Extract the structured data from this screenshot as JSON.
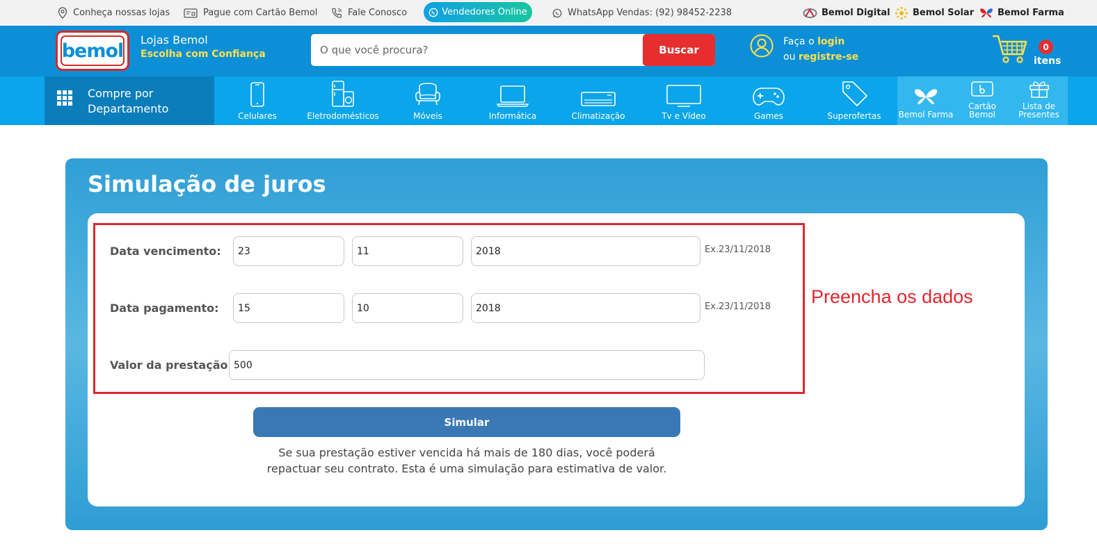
{
  "topbar": {
    "stores": "Conheça nossas lojas",
    "pay_card": "Pague com Cartão Bemol",
    "contact": "Fale Conosco",
    "sellers_online": "Vendedores Online",
    "whatsapp": "WhatsApp Vendas: (92) 98452-2238",
    "brand_digital": "Bemol Digital",
    "brand_solar": "Bemol Solar",
    "brand_farma": "Bemol Farma"
  },
  "header": {
    "logo_text": "bemol",
    "tagline_top": "Lojas Bemol",
    "tagline_bottom": "Escolha com Confiança",
    "search_placeholder": "O que você procura?",
    "search_button": "Buscar",
    "login_prefix": "Faça o",
    "login_link": "login",
    "register_prefix": "ou",
    "register_link": "registre-se",
    "cart_count": "0",
    "cart_label": "itens"
  },
  "nav": {
    "department_line1": "Compre por",
    "department_line2": "Departamento",
    "categories": [
      {
        "label": "Celulares",
        "icon": "smartphone-icon"
      },
      {
        "label": "Eletrodomésticos",
        "icon": "appliances-icon"
      },
      {
        "label": "Móveis",
        "icon": "armchair-icon"
      },
      {
        "label": "Informática",
        "icon": "laptop-icon"
      },
      {
        "label": "Climatização",
        "icon": "air-conditioner-icon"
      },
      {
        "label": "Tv e Vídeo",
        "icon": "tv-icon"
      },
      {
        "label": "Games",
        "icon": "gamepad-icon"
      },
      {
        "label": "Superofertas",
        "icon": "tag-icon"
      }
    ],
    "right_items": [
      {
        "label": "Bemol Farma",
        "icon": "butterfly-icon"
      },
      {
        "label": "Cartão Bemol",
        "icon": "card-icon"
      },
      {
        "label_line1": "Lista de",
        "label_line2": "Presentes",
        "icon": "gift-icon"
      }
    ]
  },
  "simulation": {
    "title": "Simulação de juros",
    "due_label": "Data vencimento:",
    "due_day": "23",
    "due_month": "11",
    "due_year": "2018",
    "due_hint": "Ex.23/11/2018",
    "pay_label": "Data pagamento:",
    "pay_day": "15",
    "pay_month": "10",
    "pay_year": "2018",
    "pay_hint": "Ex.23/11/2018",
    "amount_label": "Valor da prestação:",
    "amount_value": "500",
    "annotation": "Preencha os dados",
    "button": "Simular",
    "note": "Se sua prestação estiver vencida há mais de 180 dias, você poderá repactuar seu contrato. Esta é uma simulação para estimativa de valor."
  },
  "colors": {
    "header_blue": "#0c8fd6",
    "nav_blue": "#0aa5ea",
    "accent_red": "#e62e2e",
    "accent_yellow": "#ffe14d",
    "button_blue": "#3a78b5"
  }
}
